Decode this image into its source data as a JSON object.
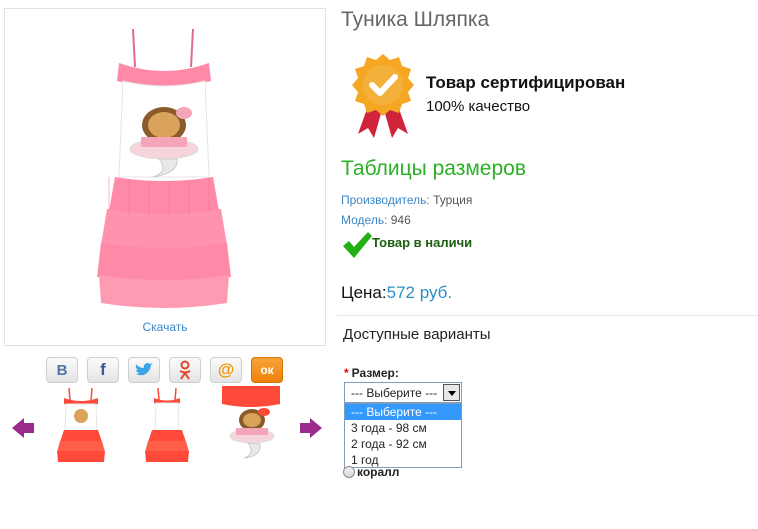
{
  "product": {
    "title": "Туника Шляпка",
    "download_label": "Скачать",
    "certificate": {
      "title": "Товар сертифицирован",
      "subtitle": "100% качество"
    },
    "size_table_link": "Таблицы размеров",
    "manufacturer": {
      "label": "Производитель:",
      "value": "Турция"
    },
    "model": {
      "label": "Модель:",
      "value": "946"
    },
    "stock_status": "Товар в наличи",
    "price": {
      "label": "Цена:",
      "value": "572 руб."
    }
  },
  "share": {
    "icons": [
      "vkontakte-icon",
      "facebook-icon",
      "twitter-icon",
      "odnoklassniki-icon",
      "mail-ru-icon",
      "ok-icon"
    ],
    "vk_letter": "В",
    "fb_letter": "f",
    "at_sign": "@",
    "ok_letter": "ок"
  },
  "options": {
    "title": "Доступные варианты",
    "size_label": "Размер:",
    "required_mark": "*",
    "size_select": {
      "selected": "--- Выберите ---",
      "options": [
        "--- Выберите ---",
        "3 года - 98 см",
        "2 года - 92 см",
        "1 год"
      ]
    },
    "color_option": "коралл"
  },
  "colors": {
    "link_blue": "#3a87c8",
    "price_blue": "#2c8fc5",
    "size_table_green": "#2ab125",
    "stock_green": "#1d5e12",
    "dress_pink": "#ff8aa8",
    "thumb_red": "#ff4a3a",
    "badge_gold": "#f5a623",
    "ribbon_red": "#d0243a",
    "arrow_purple": "#9b2c8e"
  }
}
